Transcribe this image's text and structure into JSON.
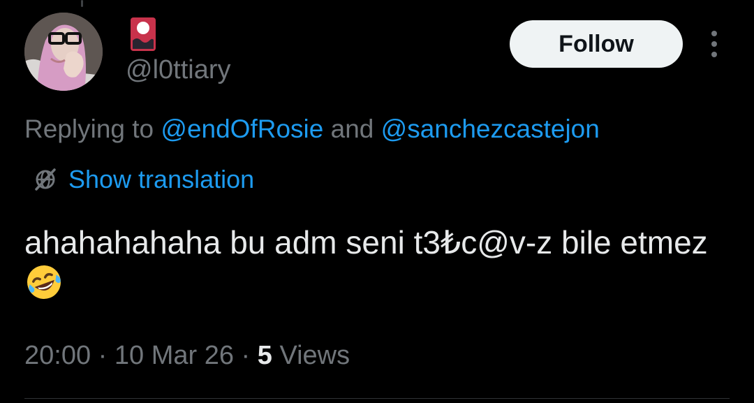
{
  "author": {
    "handle": "@l0ttiary",
    "avatar_icon": "profile-photo",
    "name_badge_icon": "red-card-emoji"
  },
  "follow_button": {
    "label": "Follow"
  },
  "more_icon": "more-vertical-icon",
  "reply": {
    "prefix": "Replying to ",
    "mention_1": "@endOfRosie",
    "conjunction": " and ",
    "mention_2": "@sanchezcastejon"
  },
  "translation": {
    "label": "Show translation",
    "icon": "globe-slash-icon"
  },
  "tweet": {
    "text": "ahahahahaha bu adm seni t3₺c@v-z bile etmez",
    "emoji": "rolling-on-floor-laughing-emoji"
  },
  "meta": {
    "time": "20:00",
    "sep_1": " · ",
    "date": "10 Mar 26",
    "sep_2": " · ",
    "views_count": "5",
    "views_label": " Views"
  },
  "colors": {
    "background": "#000000",
    "text": "#e7e9ea",
    "muted": "#71767b",
    "link": "#1d9bf0",
    "follow_bg": "#eff3f4"
  }
}
